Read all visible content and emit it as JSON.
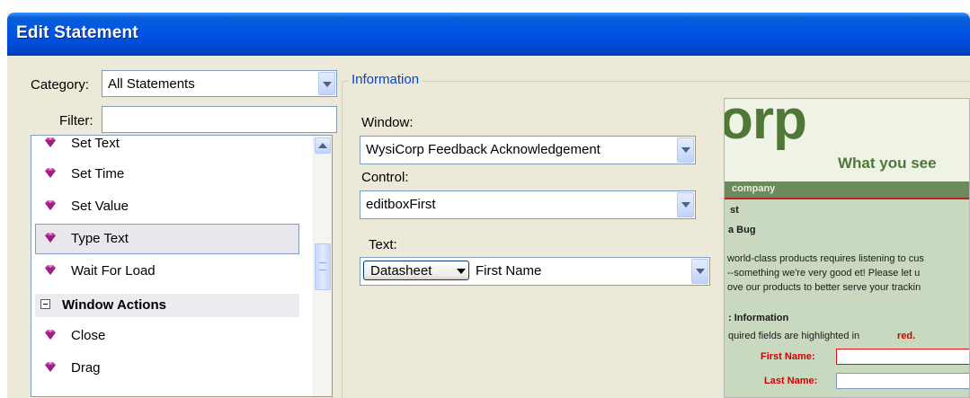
{
  "window": {
    "title": "Edit Statement"
  },
  "category": {
    "label": "Category:",
    "value": "All Statements"
  },
  "filter": {
    "label": "Filter:",
    "value": ""
  },
  "statements": {
    "items": [
      {
        "label": "Set Text"
      },
      {
        "label": "Set Time"
      },
      {
        "label": "Set Value"
      },
      {
        "label": "Type Text"
      },
      {
        "label": "Wait For Load"
      }
    ],
    "group": {
      "label": "Window Actions"
    },
    "group_items": [
      {
        "label": "Close"
      },
      {
        "label": "Drag"
      }
    ]
  },
  "information": {
    "legend": "Information",
    "window_label": "Window:",
    "window_value": "WysiCorp  Feedback Acknowledgement",
    "control_label": "Control:",
    "control_value": "editboxFirst",
    "text_label": "Text:",
    "text_source": "Datasheet",
    "text_value": "First Name"
  },
  "preview": {
    "logo_fragment": "orp",
    "tagline_fragment": "What you see",
    "bar_text": "company",
    "lines": [
      "st",
      "a Bug",
      "world-class products requires listening to cus",
      "--something we're very good et! Please let u",
      "ove our products to better serve your trackin",
      ": Information",
      "quired fields are highlighted in",
      "red.",
      "First Name:",
      "Last Name:"
    ]
  },
  "colors": {
    "title_bar": "#0055e5",
    "dialog_bg": "#ece9d8",
    "legend": "#0046d5",
    "selected_item": "#e7e7ec",
    "required_red": "#d00000"
  }
}
